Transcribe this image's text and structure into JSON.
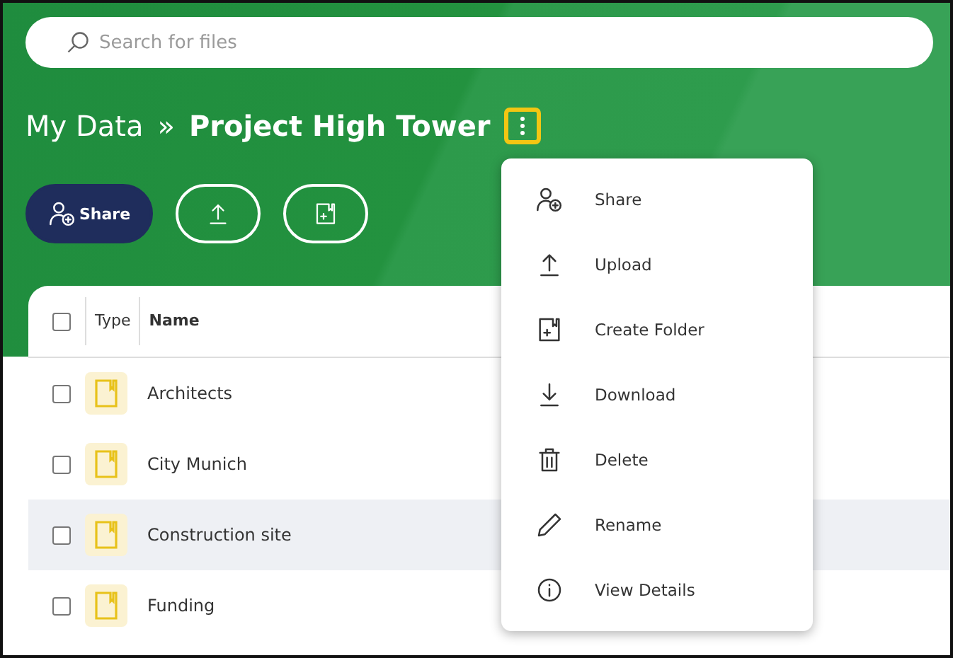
{
  "search": {
    "placeholder": "Search for files"
  },
  "breadcrumb": {
    "parent": "My Data",
    "separator": "»",
    "current": "Project High Tower",
    "menu_focused": true
  },
  "toolbar": [
    {
      "kind": "share",
      "label": "Share"
    },
    {
      "kind": "upload"
    },
    {
      "kind": "create_folder"
    }
  ],
  "table": {
    "header_checked": false,
    "columns": [
      "Type",
      "Name"
    ],
    "rows": [
      {
        "name": "Architects",
        "checked": false,
        "highlighted": false
      },
      {
        "name": "City Munich",
        "checked": false,
        "highlighted": false
      },
      {
        "name": "Construction site",
        "checked": false,
        "highlighted": true
      },
      {
        "name": "Funding",
        "checked": false,
        "highlighted": false
      }
    ]
  },
  "menu": [
    {
      "kind": "share",
      "label": "Share"
    },
    {
      "kind": "upload",
      "label": "Upload"
    },
    {
      "kind": "create_folder",
      "label": "Create Folder"
    },
    {
      "kind": "download",
      "label": "Download"
    },
    {
      "kind": "delete",
      "label": "Delete"
    },
    {
      "kind": "rename",
      "label": "Rename"
    },
    {
      "kind": "details",
      "label": "View Details"
    }
  ]
}
